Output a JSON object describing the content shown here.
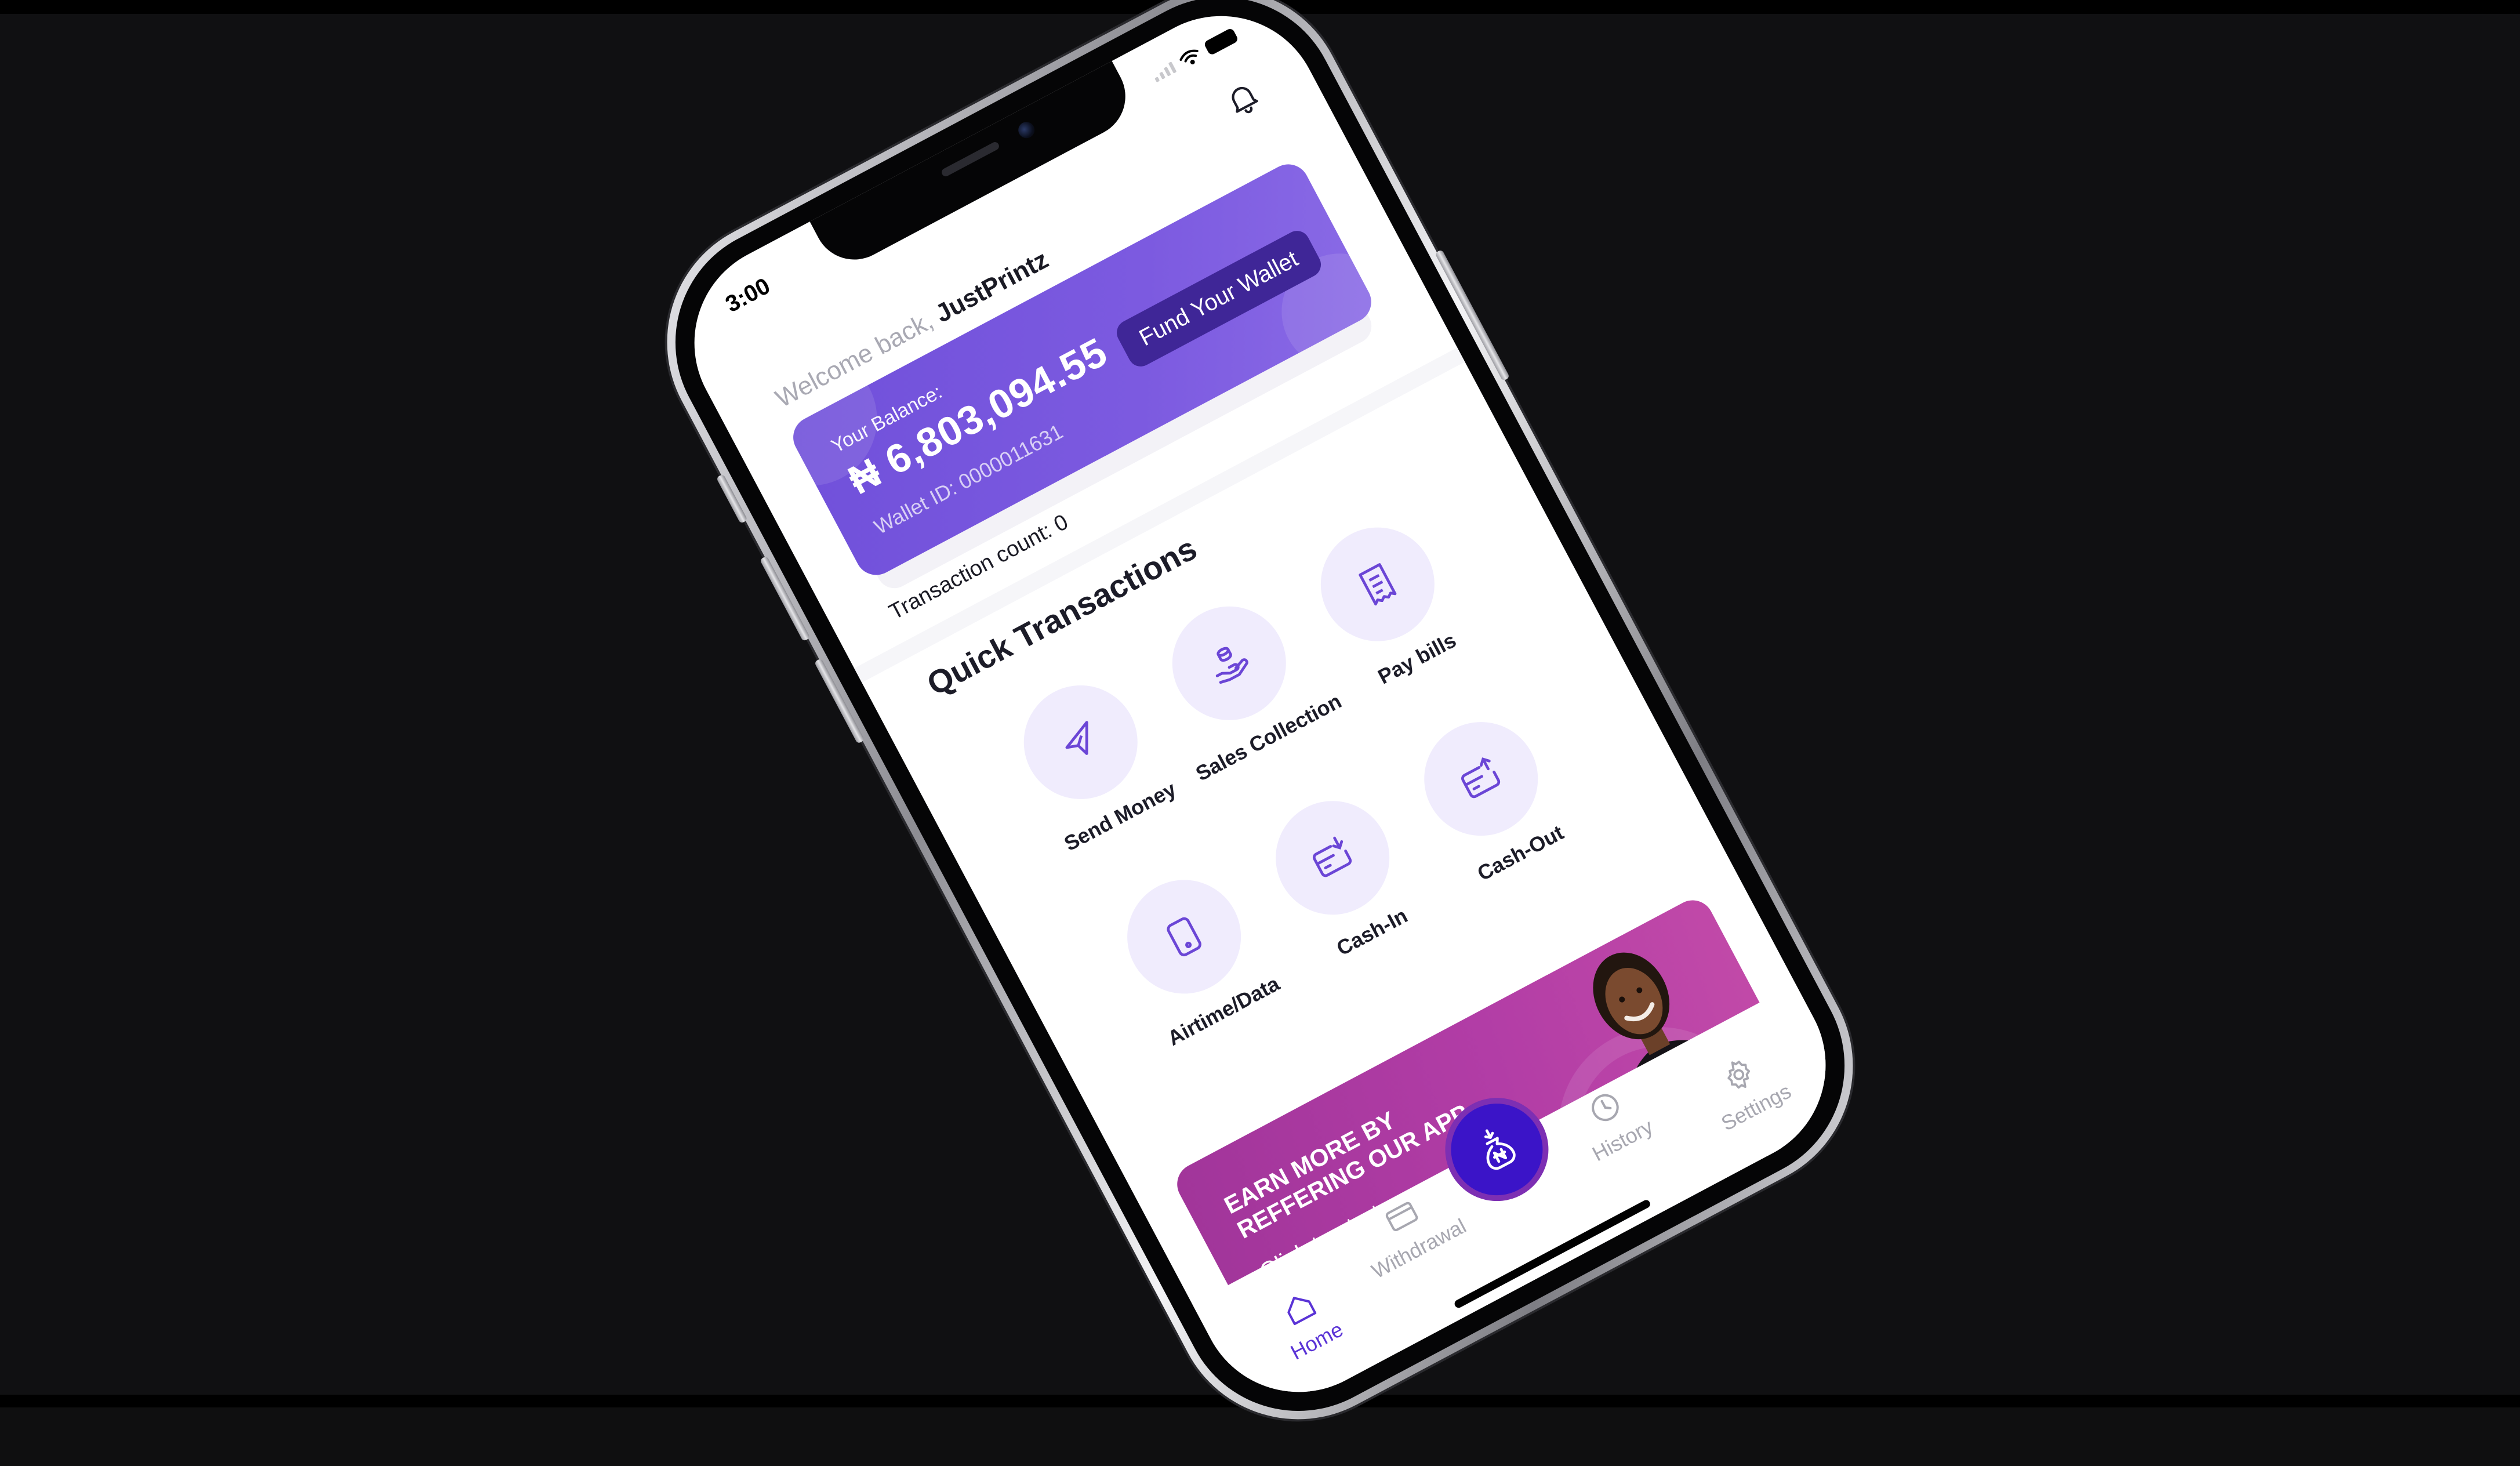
{
  "status_bar": {
    "time": "3:00"
  },
  "header": {
    "welcome_prefix": "Welcome back, ",
    "username": "JustPrintz"
  },
  "balance_card": {
    "label": "Your Balance:",
    "balance": "₦ 6,803,094.55",
    "wallet_id": "Wallet ID: 0000011631",
    "fund_button": "Fund Your Wallet",
    "color": "#7050da"
  },
  "transactions": {
    "count_text": "Transaction count: 0"
  },
  "quick_transactions": {
    "title": "Quick Transactions",
    "items": [
      {
        "label": "Send Money",
        "icon": "send-icon"
      },
      {
        "label": "Sales Collection",
        "icon": "coins-hand-icon"
      },
      {
        "label": "Pay bills",
        "icon": "receipt-icon"
      },
      {
        "label": "Airtime/Data",
        "icon": "phone-icon"
      },
      {
        "label": "Cash-In",
        "icon": "card-download-icon"
      },
      {
        "label": "Cash-Out",
        "icon": "card-upload-icon"
      }
    ]
  },
  "referral_banner": {
    "title": "EARN MORE BY REFFERING OUR APP",
    "cta": "Click to start",
    "color": "#b23da6"
  },
  "bottom_nav": {
    "items": [
      {
        "label": "Home",
        "icon": "home-icon",
        "active": true
      },
      {
        "label": "Withdrawal",
        "icon": "card-icon"
      },
      {
        "label": "History",
        "icon": "clock-icon"
      },
      {
        "label": "Settings",
        "icon": "gear-icon"
      }
    ],
    "fab_icon": "money-bag-icon",
    "accent": "#5a33d6"
  }
}
